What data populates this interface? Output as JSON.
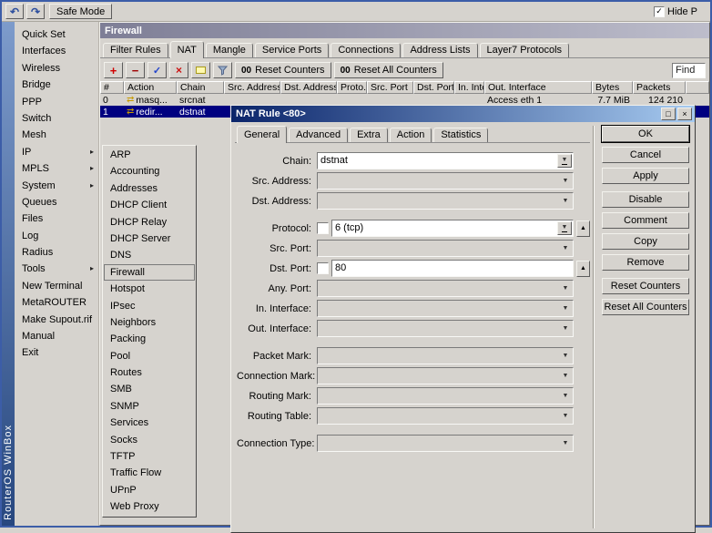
{
  "topbar": {
    "safe_mode": "Safe Mode",
    "hide_label": "Hide P"
  },
  "brand": {
    "vertical_text": "RouterOS WinBox"
  },
  "icons": {
    "undo": "↶",
    "redo": "↷",
    "check": "✓",
    "submenu_arrow": "▸",
    "add": "+",
    "remove": "−",
    "enable_check": "✓",
    "disable_cross": "×",
    "comment_note": "yellow-note-shape",
    "filter_funnel": "funnel-shape",
    "counters_badge": "00",
    "dropdown": "▼",
    "up_arrow": "▲",
    "action_nat": "⇄",
    "restore_window": "□",
    "close": "×"
  },
  "colors": {
    "base": "#d6d3ce",
    "selection": "#000080",
    "active_title_start": "#0a246a",
    "active_title_end": "#a6caf0",
    "inactive_title_start": "#7e7e96",
    "inactive_title_end": "#bdbdcb"
  },
  "sidebar": {
    "items": [
      "Quick Set",
      "Interfaces",
      "Wireless",
      "Bridge",
      "PPP",
      "Switch",
      "Mesh",
      "IP",
      "MPLS",
      "System",
      "Queues",
      "Files",
      "Log",
      "Radius",
      "Tools",
      "New Terminal",
      "MetaROUTER",
      "Make Supout.rif",
      "Manual",
      "Exit"
    ]
  },
  "ip_menu": {
    "selected": "Firewall",
    "items": [
      "ARP",
      "Accounting",
      "Addresses",
      "DHCP Client",
      "DHCP Relay",
      "DHCP Server",
      "DNS",
      "Firewall",
      "Hotspot",
      "IPsec",
      "Neighbors",
      "Packing",
      "Pool",
      "Routes",
      "SMB",
      "SNMP",
      "Services",
      "Socks",
      "TFTP",
      "Traffic Flow",
      "UPnP",
      "Web Proxy"
    ]
  },
  "firewall": {
    "title": "Firewall",
    "tabs": [
      "Filter Rules",
      "NAT",
      "Mangle",
      "Service Ports",
      "Connections",
      "Address Lists",
      "Layer7 Protocols"
    ],
    "active_tab": "NAT",
    "toolbar": {
      "reset_counters": "Reset Counters",
      "reset_all_counters": "Reset All Counters",
      "find": "Find"
    },
    "columns": [
      "#",
      "Action",
      "Chain",
      "Src. Address",
      "Dst. Address",
      "Proto...",
      "Src. Port",
      "Dst. Port",
      "In. Inter...",
      "Out. Interface",
      "Bytes",
      "Packets"
    ],
    "rows": [
      {
        "num": "0",
        "action": "masq...",
        "chain": "srcnat",
        "out_interface": "Access eth 1",
        "bytes": "7.7 MiB",
        "packets": "124 210"
      },
      {
        "num": "1",
        "action": "redir...",
        "chain": "dstnat",
        "out_interface": "",
        "bytes": "",
        "packets": ""
      }
    ]
  },
  "dialog": {
    "title": "NAT Rule <80>",
    "tabs": [
      "General",
      "Advanced",
      "Extra",
      "Action",
      "Statistics"
    ],
    "active_tab": "General",
    "fields": {
      "chain": {
        "label": "Chain:",
        "value": "dstnat"
      },
      "src_address": {
        "label": "Src. Address:",
        "value": ""
      },
      "dst_address": {
        "label": "Dst. Address:",
        "value": ""
      },
      "protocol": {
        "label": "Protocol:",
        "value": "6 (tcp)"
      },
      "src_port": {
        "label": "Src. Port:",
        "value": ""
      },
      "dst_port": {
        "label": "Dst. Port:",
        "value": "80"
      },
      "any_port": {
        "label": "Any. Port:",
        "value": ""
      },
      "in_interface": {
        "label": "In. Interface:",
        "value": ""
      },
      "out_interface": {
        "label": "Out. Interface:",
        "value": ""
      },
      "packet_mark": {
        "label": "Packet Mark:",
        "value": ""
      },
      "connection_mark": {
        "label": "Connection Mark:",
        "value": ""
      },
      "routing_mark": {
        "label": "Routing Mark:",
        "value": ""
      },
      "routing_table": {
        "label": "Routing Table:",
        "value": ""
      },
      "connection_type": {
        "label": "Connection Type:",
        "value": ""
      }
    },
    "buttons": [
      "OK",
      "Cancel",
      "Apply",
      "Disable",
      "Comment",
      "Copy",
      "Remove",
      "Reset Counters",
      "Reset All Counters"
    ]
  }
}
